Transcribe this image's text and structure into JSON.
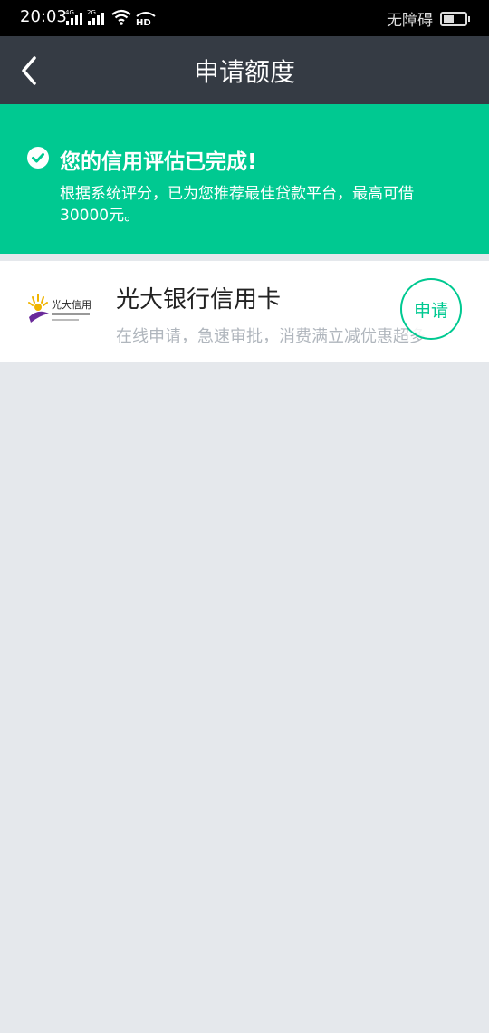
{
  "status_bar": {
    "time": "20:03",
    "network_1": "4G",
    "network_2": "2G",
    "hd_label": "HD",
    "accessibility": "无障碍"
  },
  "header": {
    "title": "申请额度",
    "back_icon": "chevron-left-icon"
  },
  "banner": {
    "title": "您的信用评估已完成!",
    "description": "根据系统评分，已为您推荐最佳贷款平台，最高可借30000元。",
    "check_icon": "check-circle-icon",
    "color": "#00c991"
  },
  "products": [
    {
      "name": "光大银行信用卡",
      "description": "在线申请，急速审批，消费满立减优惠超多",
      "apply_label": "申请",
      "logo_text": "光大信用卡"
    }
  ],
  "colors": {
    "nav_bg": "#353b44",
    "accent": "#00c991",
    "page_bg": "#e5e8ec"
  }
}
